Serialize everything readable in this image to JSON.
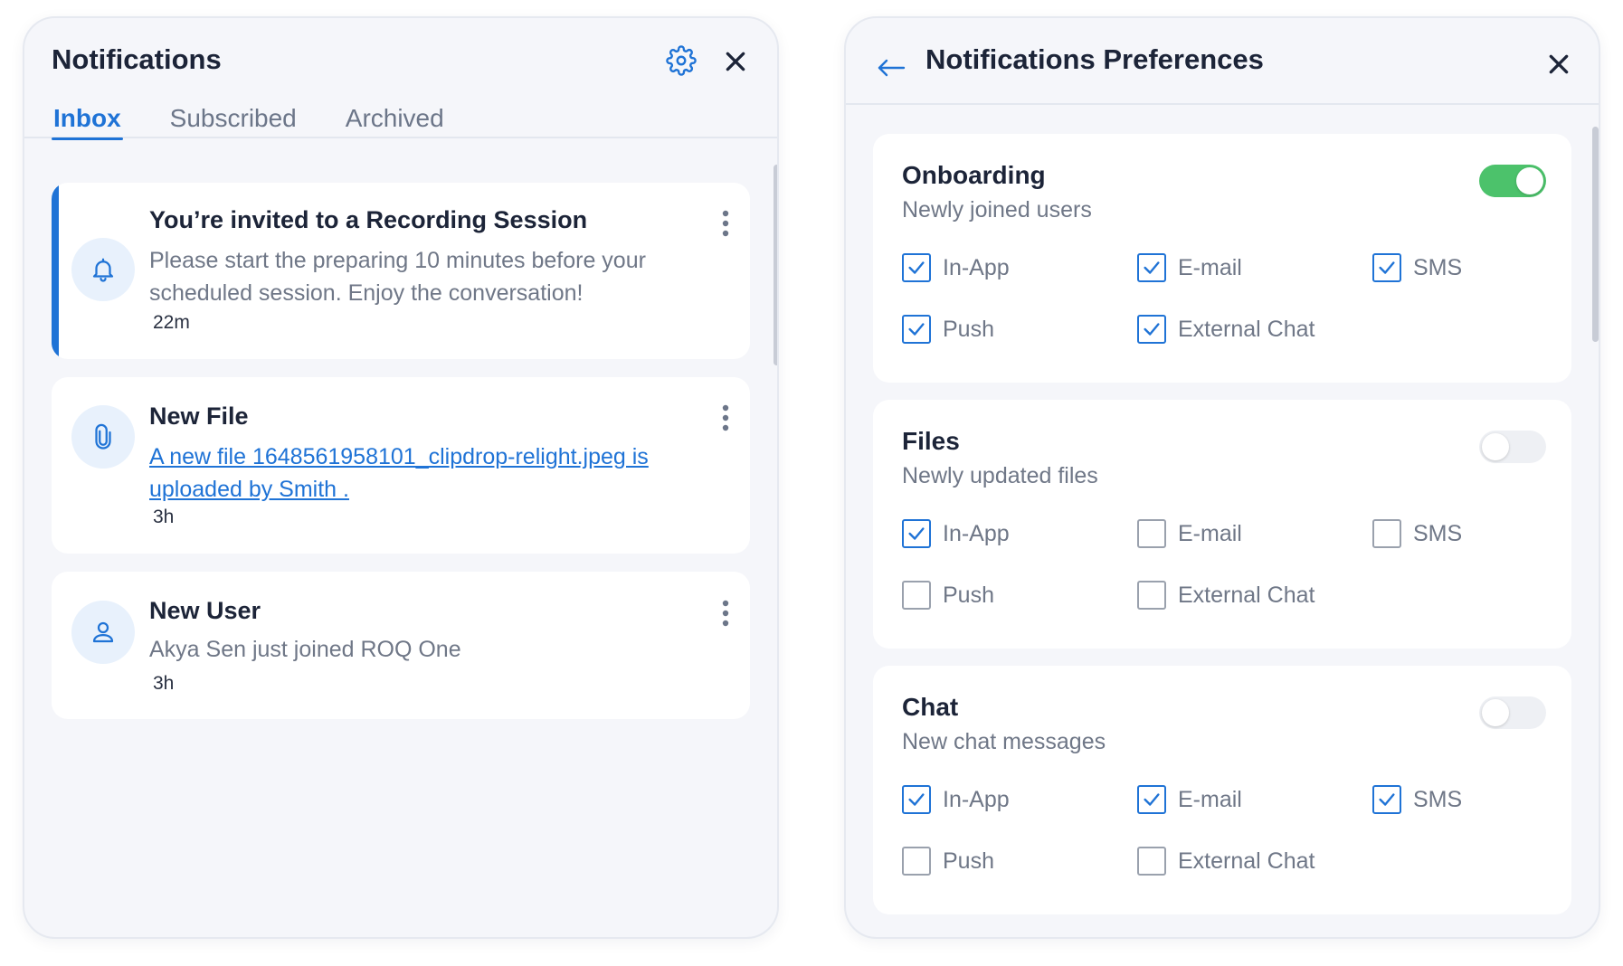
{
  "notifications_panel": {
    "title": "Notifications",
    "tabs": [
      {
        "label": "Inbox",
        "active": true
      },
      {
        "label": "Subscribed",
        "active": false
      },
      {
        "label": "Archived",
        "active": false
      }
    ],
    "items": [
      {
        "icon": "bell-icon",
        "title": "You’re invited to a Recording Session",
        "body": "Please start the preparing 10 minutes before your scheduled session. Enjoy the conversation!",
        "time": "22m",
        "unread": true
      },
      {
        "icon": "paperclip-icon",
        "title": "New File",
        "link_text": "A new file 1648561958101_clipdrop-relight.jpeg is uploaded by Smith .",
        "time": "3h",
        "unread": false
      },
      {
        "icon": "user-icon",
        "title": "New User",
        "body": "Akya Sen just joined ROQ One",
        "time": "3h",
        "unread": false
      }
    ]
  },
  "preferences_panel": {
    "title": "Notifications Preferences",
    "groups": [
      {
        "title": "Onboarding",
        "subtitle": "Newly joined users",
        "enabled": true,
        "channels": [
          {
            "label": "In-App",
            "checked": true
          },
          {
            "label": "E-mail",
            "checked": true
          },
          {
            "label": "SMS",
            "checked": true
          },
          {
            "label": "Push",
            "checked": true
          },
          {
            "label": "External Chat",
            "checked": true
          }
        ]
      },
      {
        "title": "Files",
        "subtitle": "Newly updated files",
        "enabled": false,
        "channels": [
          {
            "label": "In-App",
            "checked": true
          },
          {
            "label": "E-mail",
            "checked": false
          },
          {
            "label": "SMS",
            "checked": false
          },
          {
            "label": "Push",
            "checked": false
          },
          {
            "label": "External Chat",
            "checked": false
          }
        ]
      },
      {
        "title": "Chat",
        "subtitle": "New chat messages",
        "enabled": false,
        "channels": [
          {
            "label": "In-App",
            "checked": true
          },
          {
            "label": "E-mail",
            "checked": true
          },
          {
            "label": "SMS",
            "checked": true
          },
          {
            "label": "Push",
            "checked": false
          },
          {
            "label": "External Chat",
            "checked": false
          }
        ]
      }
    ]
  },
  "colors": {
    "accent": "#1f73d6",
    "toggle_on": "#4cc26b",
    "panel_bg": "#f5f6fa",
    "card_bg": "#ffffff"
  }
}
